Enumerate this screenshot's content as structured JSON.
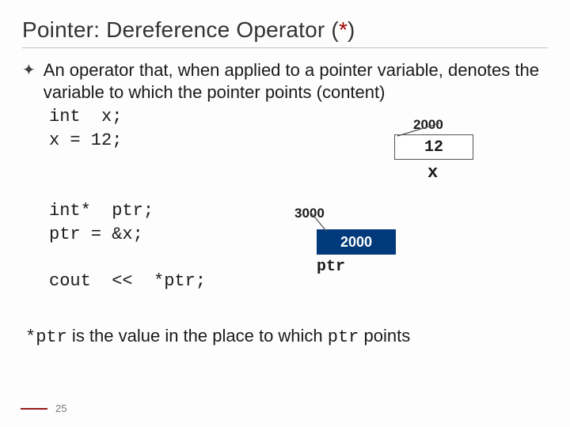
{
  "title": {
    "pre": "Pointer: Dereference Operator (",
    "star": "*",
    "post": ")"
  },
  "bullet": "An operator that, when applied to a pointer variable, denotes the variable to which the pointer points (content)",
  "code": {
    "l1": "int  x;",
    "l2": "x = 12;",
    "l3": "int*  ptr;",
    "l4": "ptr = &x;",
    "l5": "cout  <<  *ptr;"
  },
  "diagram": {
    "addr_x": "2000",
    "val_x": "12",
    "label_x": "x",
    "addr_ptr": "3000",
    "val_ptr": "2000",
    "label_ptr": "ptr"
  },
  "footnote": {
    "a": "*ptr",
    "b": " is the value in the place to which ",
    "c": "ptr",
    "d": "  points"
  },
  "page_number": "25"
}
